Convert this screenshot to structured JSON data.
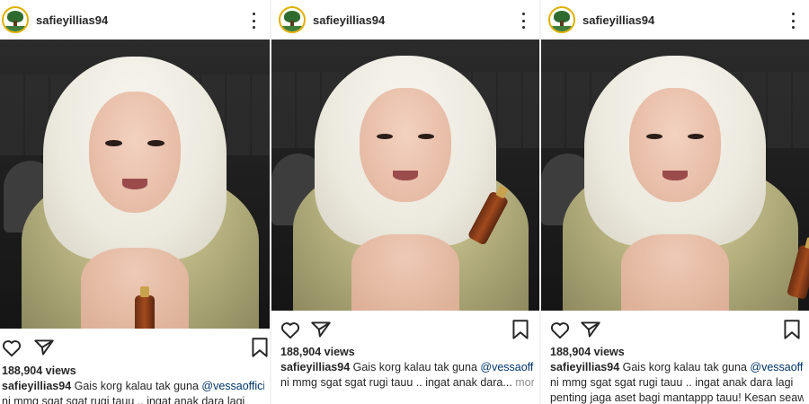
{
  "posts": [
    {
      "username": "safieyillias94",
      "views": "188,904 views",
      "caption_user": "safieyillias94",
      "caption_text": " Gais korg kalau tak guna ",
      "mention": "@vessaofficial",
      "caption_line2": "ni mmg sgat sgat rugi tauu .. ingat anak dara lagi",
      "more_label": ""
    },
    {
      "username": "safieyillias94",
      "views": "188,904 views",
      "caption_user": "safieyillias94",
      "caption_text": " Gais korg kalau tak guna ",
      "mention": "@vessaofficial",
      "caption_line2": "ni mmg sgat sgat rugi tauu .. ingat anak dara...",
      "more_label": " more"
    },
    {
      "username": "safieyillias94",
      "views": "188,904 views",
      "caption_user": "safieyillias94",
      "caption_text": " Gais korg kalau tak guna ",
      "mention": "@vessaofficial",
      "caption_line2": "ni mmg sgat sgat rugi tauu .. ingat anak dara lagi",
      "caption_line3": "penting jaga aset bagi mantappp tauu! Kesan seawal",
      "more_label": ""
    }
  ],
  "icons": {
    "avatar": "profile-avatar",
    "menu": "more-options-icon",
    "like": "heart-icon",
    "share": "paper-plane-icon",
    "save": "bookmark-icon"
  },
  "colors": {
    "text": "#262626",
    "mention": "#003569",
    "muted": "#8e8e8e"
  }
}
